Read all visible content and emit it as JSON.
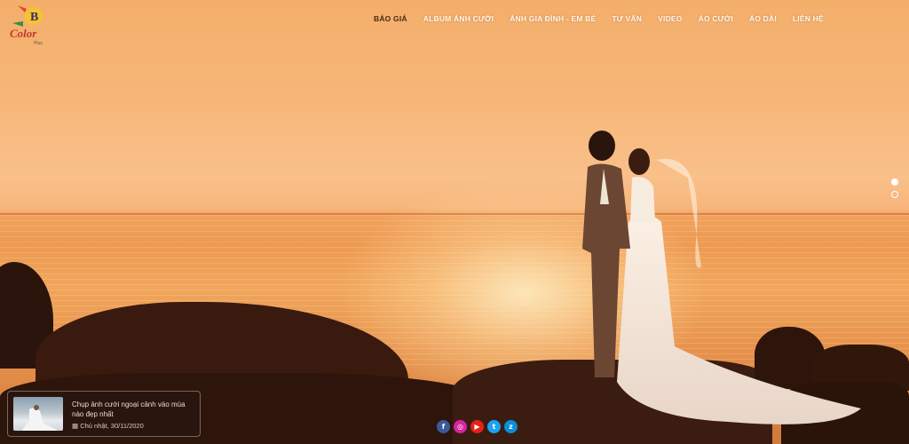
{
  "brand": {
    "logo_letter": "B",
    "logo_word": "Color",
    "logo_sub": "Plus"
  },
  "nav": {
    "items": [
      {
        "label": "BÁO GIÁ",
        "active": true
      },
      {
        "label": "ALBUM ẢNH CƯỚI"
      },
      {
        "label": "ẢNH GIA ĐÌNH - EM BÉ"
      },
      {
        "label": "TƯ VẤN"
      },
      {
        "label": "VIDEO"
      },
      {
        "label": "ÁO CƯỚI"
      },
      {
        "label": "ÁO DÀI"
      },
      {
        "label": "LIÊN HỆ"
      }
    ]
  },
  "slider": {
    "dots": [
      {
        "active": true
      },
      {
        "active": false
      }
    ]
  },
  "news": {
    "title": "Chụp ảnh cưới ngoại cảnh vào mùa nào đẹp nhất",
    "date_icon": "calendar-icon",
    "date": "Chủ nhật, 30/11/2020"
  },
  "social": [
    {
      "name": "facebook-icon",
      "glyph": "f",
      "color": "#3b5998"
    },
    {
      "name": "instagram-icon",
      "glyph": "◎",
      "color": "#d6249f"
    },
    {
      "name": "youtube-icon",
      "glyph": "▶",
      "color": "#e62117"
    },
    {
      "name": "twitter-icon",
      "glyph": "t",
      "color": "#1da1f2"
    },
    {
      "name": "zalo-icon",
      "glyph": "z",
      "color": "#0a8fd8"
    }
  ]
}
